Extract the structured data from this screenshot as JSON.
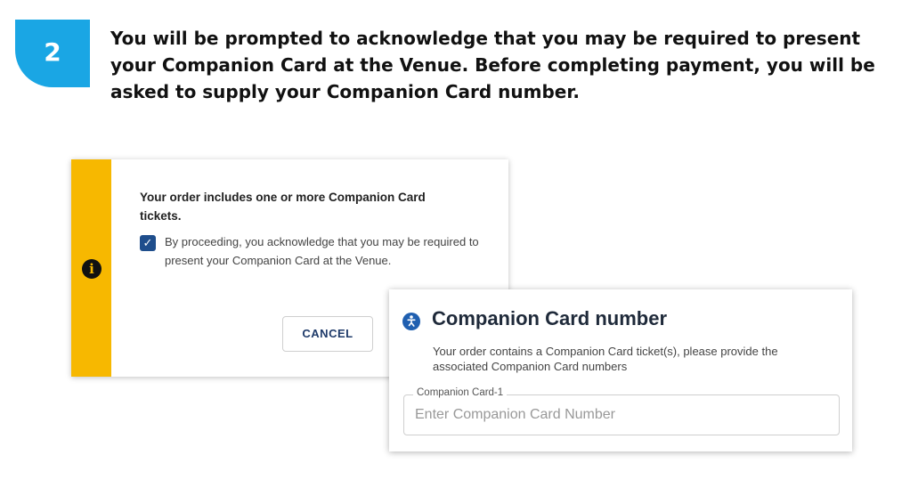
{
  "step": {
    "number": "2"
  },
  "instruction": "You will be prompted to acknowledge that you may be required to present your Companion Card at the Venue. Before completing payment, you will be asked to supply your Companion Card number.",
  "dialog1": {
    "title": "Your order includes one or more Companion Card tickets.",
    "checkbox_checked": true,
    "ack_text": "By proceeding, you acknowledge that you may be required to present your Companion Card at the Venue.",
    "cancel_label": "CANCEL"
  },
  "dialog2": {
    "title": "Companion Card number",
    "description": "Your order contains a Companion Card ticket(s), please provide the associated Companion Card numbers",
    "field_label": "Companion Card-1",
    "field_placeholder": "Enter Companion Card Number"
  },
  "colors": {
    "accent_blue": "#1aa6e4",
    "warning_yellow": "#f7b800",
    "checkbox_blue": "#1f4e8c"
  },
  "icons": {
    "info": "info-icon",
    "accessibility": "accessibility-icon",
    "check": "check-icon"
  }
}
